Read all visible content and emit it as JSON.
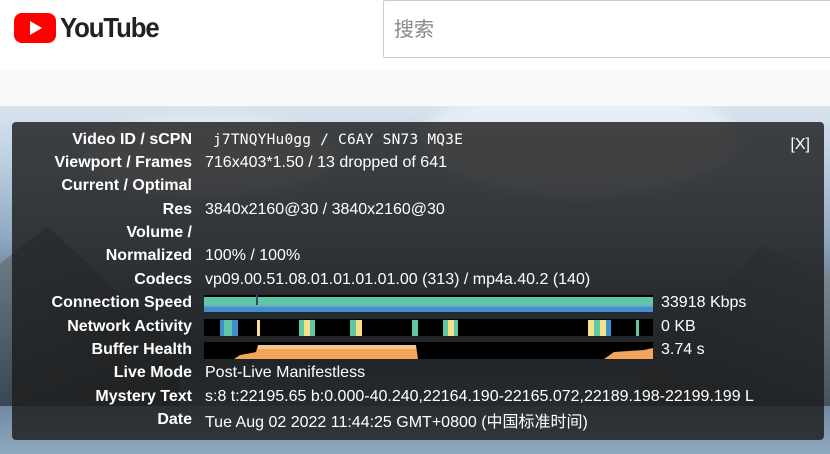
{
  "brand": {
    "name": "YouTube"
  },
  "search": {
    "placeholder": "搜索"
  },
  "stats_panel": {
    "close_label": "[X]",
    "rows": {
      "video_id": {
        "label": "Video ID / sCPN",
        "value": "j7TNQYHu0gg / C6AY SN73 MQ3E"
      },
      "viewport": {
        "label": "Viewport / Frames",
        "value": "716x403*1.50 / 13 dropped of 641"
      },
      "current_optimal": {
        "label": "Current / Optimal",
        "value": ""
      },
      "res": {
        "label": "Res",
        "value": "3840x2160@30 / 3840x2160@30"
      },
      "volume": {
        "label": "Volume /",
        "value": ""
      },
      "normalized": {
        "label": "Normalized",
        "value": "100% / 100%"
      },
      "codecs": {
        "label": "Codecs",
        "value": "vp09.00.51.08.01.01.01.01.00 (313) / mp4a.40.2 (140)"
      },
      "connection_speed": {
        "label": "Connection Speed",
        "value": "33918 Kbps"
      },
      "network_activity": {
        "label": "Network Activity",
        "value": "0 KB"
      },
      "buffer_health": {
        "label": "Buffer Health",
        "value": "3.74 s"
      },
      "live_mode": {
        "label": "Live Mode",
        "value": "Post-Live Manifestless"
      },
      "mystery_text": {
        "label": "Mystery Text",
        "value": "s:8 t:22195.65 b:0.000-40.240,22164.190-22165.072,22189.198-22199.199 L"
      },
      "date": {
        "label": "Date",
        "value": "Tue Aug 02 2022 11:44:25 GMT+0800 (中国标准时间)"
      }
    }
  },
  "colors": {
    "brand_red": "#ff0000",
    "panel_bg": "#1c1c1c",
    "graph_teal": "#5fc6a8",
    "graph_blue": "#3f8fd0",
    "graph_orange": "#f2a45a",
    "graph_yellow": "#f7e08a"
  }
}
